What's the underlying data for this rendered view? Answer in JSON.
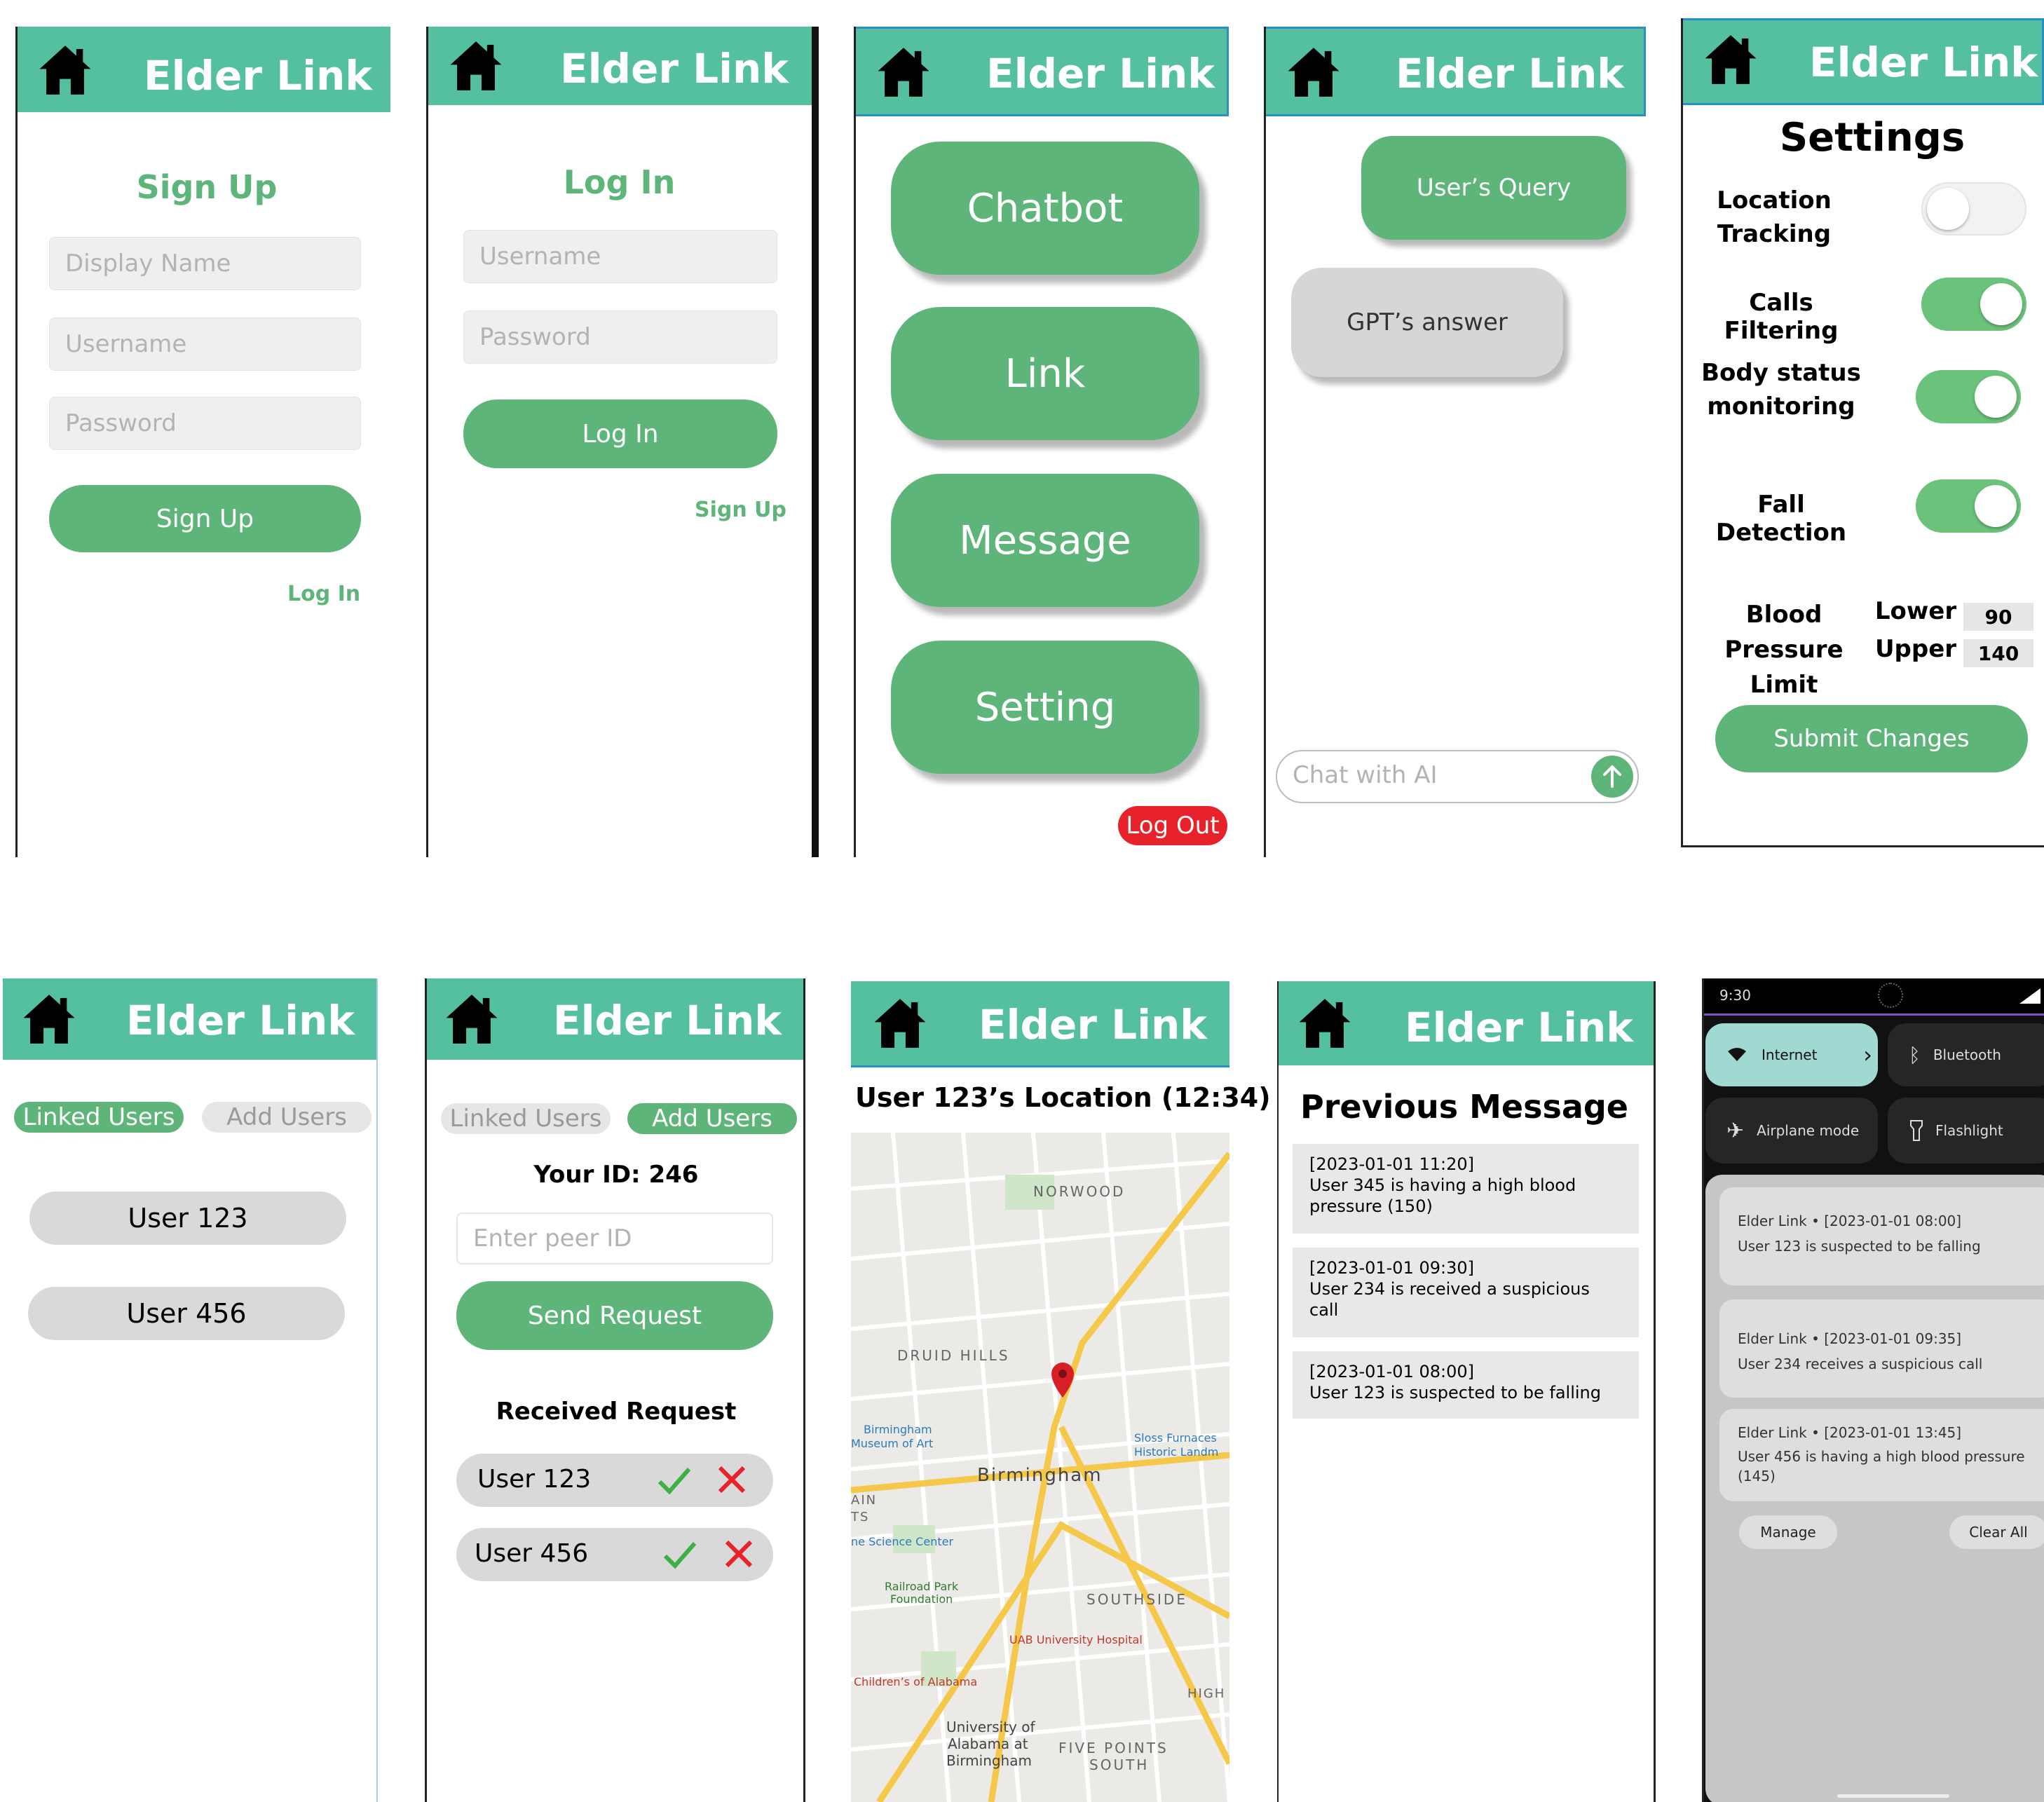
{
  "app_title": "Elder Link",
  "signup": {
    "heading": "Sign Up",
    "display_name_placeholder": "Display Name",
    "username_placeholder": "Username",
    "password_placeholder": "Password",
    "button": "Sign Up",
    "login_link": "Log In"
  },
  "login": {
    "heading": "Log In",
    "username_placeholder": "Username",
    "password_placeholder": "Password",
    "button": "Log In",
    "signup_link": "Sign Up"
  },
  "menu": {
    "chatbot": "Chatbot",
    "link": "Link",
    "message": "Message",
    "setting": "Setting",
    "logout": "Log Out"
  },
  "chat": {
    "user_query": "User’s Query",
    "gpt_answer": "GPT’s answer",
    "input_placeholder": "Chat with AI"
  },
  "settings": {
    "heading": "Settings",
    "location_tracking_1": "Location",
    "location_tracking_2": "Tracking",
    "calls_filtering": "Calls Filtering",
    "body_status_1": "Body status",
    "body_status_2": "monitoring",
    "fall_detection": "Fall Detection",
    "bp_label_1": "Blood Pressure",
    "bp_label_2": "Limit",
    "lower_label": "Lower",
    "upper_label": "Upper",
    "lower_value": "90",
    "upper_value": "140",
    "submit": "Submit Changes",
    "toggles": {
      "location_tracking": false,
      "calls_filtering": true,
      "body_status": true,
      "fall_detection": true
    }
  },
  "linked": {
    "tab_linked": "Linked Users",
    "tab_add": "Add Users",
    "users": [
      "User 123",
      "User 456"
    ]
  },
  "add": {
    "tab_linked": "Linked Users",
    "tab_add": "Add Users",
    "your_id": "Your ID: 246",
    "peer_placeholder": "Enter peer ID",
    "send": "Send Request",
    "received_heading": "Received Request",
    "requests": [
      "User 123",
      "User 456"
    ]
  },
  "location": {
    "heading": "User 123’s Location (12:34)",
    "map_labels": [
      "NORWOOD",
      "DRUID HILLS",
      "Birmingham",
      "SOUTHSIDE",
      "FIVE POINTS",
      "SOUTH",
      "Birmingham",
      "Museum of Art",
      "Sloss Furnaces",
      "Historic Landm",
      "ne Science Center",
      "Railroad Park",
      "Foundation",
      "UAB University Hospital",
      "Children’s of Alabama",
      "University of",
      "Alabama at",
      "Birmingham",
      "HIGH",
      "AIN",
      "TS"
    ]
  },
  "previous": {
    "heading": "Previous Message",
    "messages": [
      {
        "time": "[2023-01-01 11:20]",
        "text1": "User 345 is having a high blood",
        "text2": "pressure (150)"
      },
      {
        "time": "[2023-01-01 09:30]",
        "text1": "User 234 is received a suspicious",
        "text2": "call"
      },
      {
        "time": "[2023-01-01 08:00]",
        "text1": "User 123 is suspected to be falling",
        "text2": ""
      }
    ]
  },
  "notifications": {
    "clock": "9:30",
    "tiles": [
      "Internet",
      "Bluetooth",
      "Airplane mode",
      "Flashlight"
    ],
    "items": [
      {
        "title": "Elder Link • [2023-01-01 08:00]",
        "body1": "User 123 is suspected to be falling",
        "body2": ""
      },
      {
        "title": "Elder Link • [2023-01-01 09:35]",
        "body1": "User 234 receives a suspicious call",
        "body2": ""
      },
      {
        "title": "Elder Link • [2023-01-01 13:45]",
        "body1": "User 456 is having a high blood pressure",
        "body2": "(145)"
      }
    ],
    "manage": "Manage",
    "clear_all": "Clear All"
  },
  "colors": {
    "header": "#54c0a0",
    "accent": "#5db579",
    "logout": "#e8222a",
    "reject": "#e8222a",
    "accept": "#3cb043"
  }
}
